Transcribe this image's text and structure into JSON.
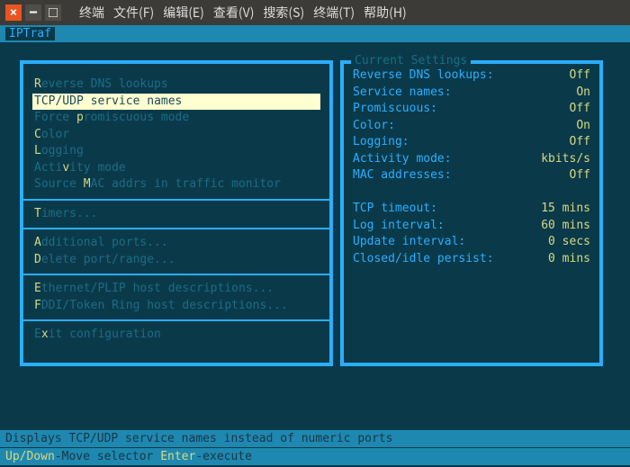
{
  "window": {
    "close_glyph": "×",
    "min_glyph": "━"
  },
  "menubar": [
    "终端",
    "文件(F)",
    "编辑(E)",
    "查看(V)",
    "搜索(S)",
    "终端(T)",
    "帮助(H)"
  ],
  "app_title": "IPTraf",
  "menu": {
    "items": [
      {
        "text": "Reverse DNS lookups",
        "hk": 0
      },
      {
        "text": "TCP/UDP service names",
        "hk": 8,
        "selected": true
      },
      {
        "text": "Force promiscuous mode",
        "hk": 6
      },
      {
        "text": "Color",
        "hk": 0
      },
      {
        "text": "Logging",
        "hk": 0
      },
      {
        "text": "Activity mode",
        "hk": 4
      },
      {
        "text": "Source MAC addrs in traffic monitor",
        "hk": 7
      }
    ],
    "group2": [
      {
        "text": "Timers...",
        "hk": 0
      }
    ],
    "group3": [
      {
        "text": "Additional ports...",
        "hk": 0
      },
      {
        "text": "Delete port/range...",
        "hk": 0
      }
    ],
    "group4": [
      {
        "text": "Ethernet/PLIP host descriptions...",
        "hk": 0
      },
      {
        "text": "FDDI/Token Ring host descriptions...",
        "hk": 0
      }
    ],
    "group5": [
      {
        "text": "Exit configuration",
        "hk": 1
      }
    ]
  },
  "settings": {
    "title": " Current Settings ",
    "rows": [
      {
        "label": "Reverse DNS lookups:",
        "value": "Off"
      },
      {
        "label": "Service names:",
        "value": "On"
      },
      {
        "label": "Promiscuous:",
        "value": "Off"
      },
      {
        "label": "Color:",
        "value": "On"
      },
      {
        "label": "Logging:",
        "value": "Off"
      },
      {
        "label": "Activity mode:",
        "value": "kbits/s"
      },
      {
        "label": "MAC addresses:",
        "value": "Off"
      }
    ],
    "rows2": [
      {
        "label": "TCP timeout:",
        "value": "15 mins"
      },
      {
        "label": "Log interval:",
        "value": "60 mins"
      },
      {
        "label": "Update interval:",
        "value": "0 secs"
      },
      {
        "label": "Closed/idle persist:",
        "value": "0 mins"
      }
    ]
  },
  "status": "Displays TCP/UDP service names instead of numeric ports",
  "help": {
    "k1": "Up/Down",
    "t1": "-Move selector  ",
    "k2": "Enter",
    "t2": "-execute"
  }
}
